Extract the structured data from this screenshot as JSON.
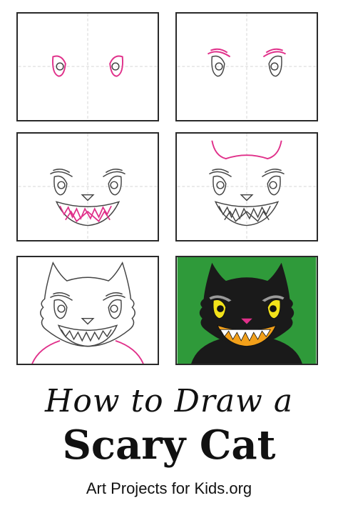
{
  "colors": {
    "outline": "#3a3a3a",
    "new_step": "#e0308a",
    "guide": "#cfcfcf",
    "background_green": "#2f9a3a",
    "cat_black": "#1a1a1a",
    "eye_yellow": "#f2e21a",
    "mouth_orange": "#f2a01a",
    "nose_pink": "#e0308a"
  },
  "steps": [
    {
      "icon": "step-1-eyes-sketch"
    },
    {
      "icon": "step-2-eyebrows-sketch"
    },
    {
      "icon": "step-3-face-mouth-sketch"
    },
    {
      "icon": "step-4-ears-sketch"
    },
    {
      "icon": "step-5-body-sketch"
    },
    {
      "icon": "step-6-colored-cat"
    }
  ],
  "title": {
    "line1": "How to Draw a",
    "line2": "Scary Cat",
    "line3": "Art Projects for Kids.org"
  }
}
